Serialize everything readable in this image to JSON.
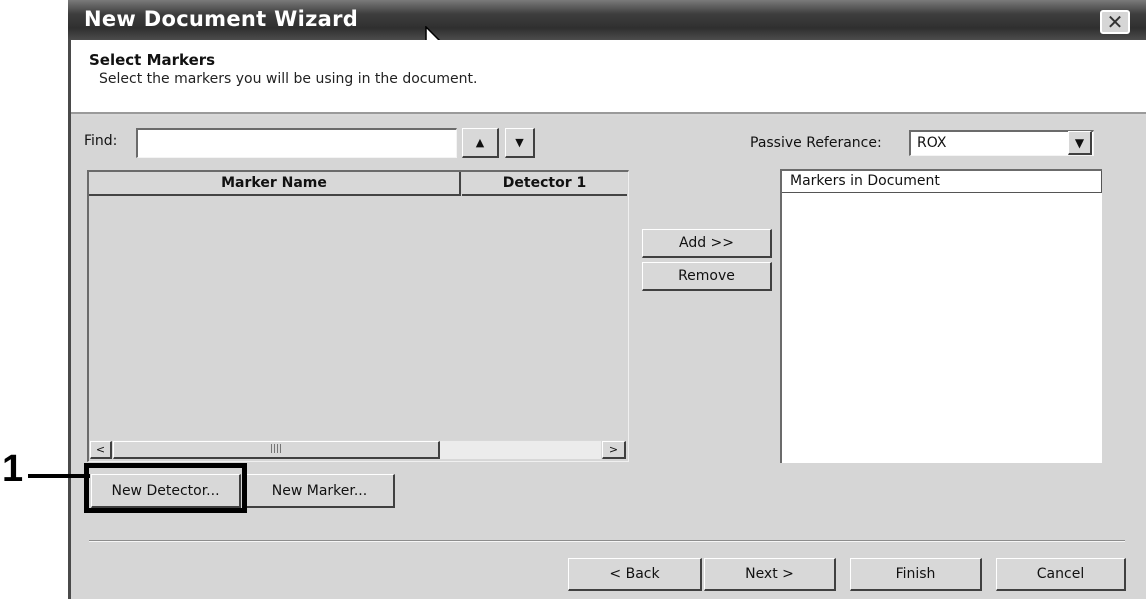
{
  "window": {
    "title": "New Document Wizard",
    "close_symbol": "✕"
  },
  "header": {
    "title": "Select Markers",
    "subtitle": "Select the markers you will be using in the document."
  },
  "find": {
    "label": "Find:",
    "value": "",
    "up_icon": "▲",
    "down_icon": "▼"
  },
  "passive_reference": {
    "label": "Passive Referance:",
    "selected": "ROX",
    "arrow_icon": "▼"
  },
  "marker_table": {
    "columns": [
      "Marker Name",
      "Detector 1"
    ],
    "rows": [],
    "scroll_left_icon": "<",
    "scroll_right_icon": ">",
    "scroll_grip": "||||"
  },
  "middle_buttons": {
    "add": "Add >>",
    "remove": "Remove"
  },
  "document_markers": {
    "header": "Markers in Document",
    "items": []
  },
  "bottom_buttons": {
    "new_detector": "New Detector...",
    "new_marker": "New Marker..."
  },
  "annotation": {
    "number": "1"
  },
  "nav_buttons": {
    "back": "< Back",
    "next": "Next >",
    "finish": "Finish",
    "cancel": "Cancel"
  },
  "colors": {
    "titlebar": "#3e3e3e",
    "dialog_bg": "#d6d6d6",
    "header_bg": "#ffffff"
  }
}
